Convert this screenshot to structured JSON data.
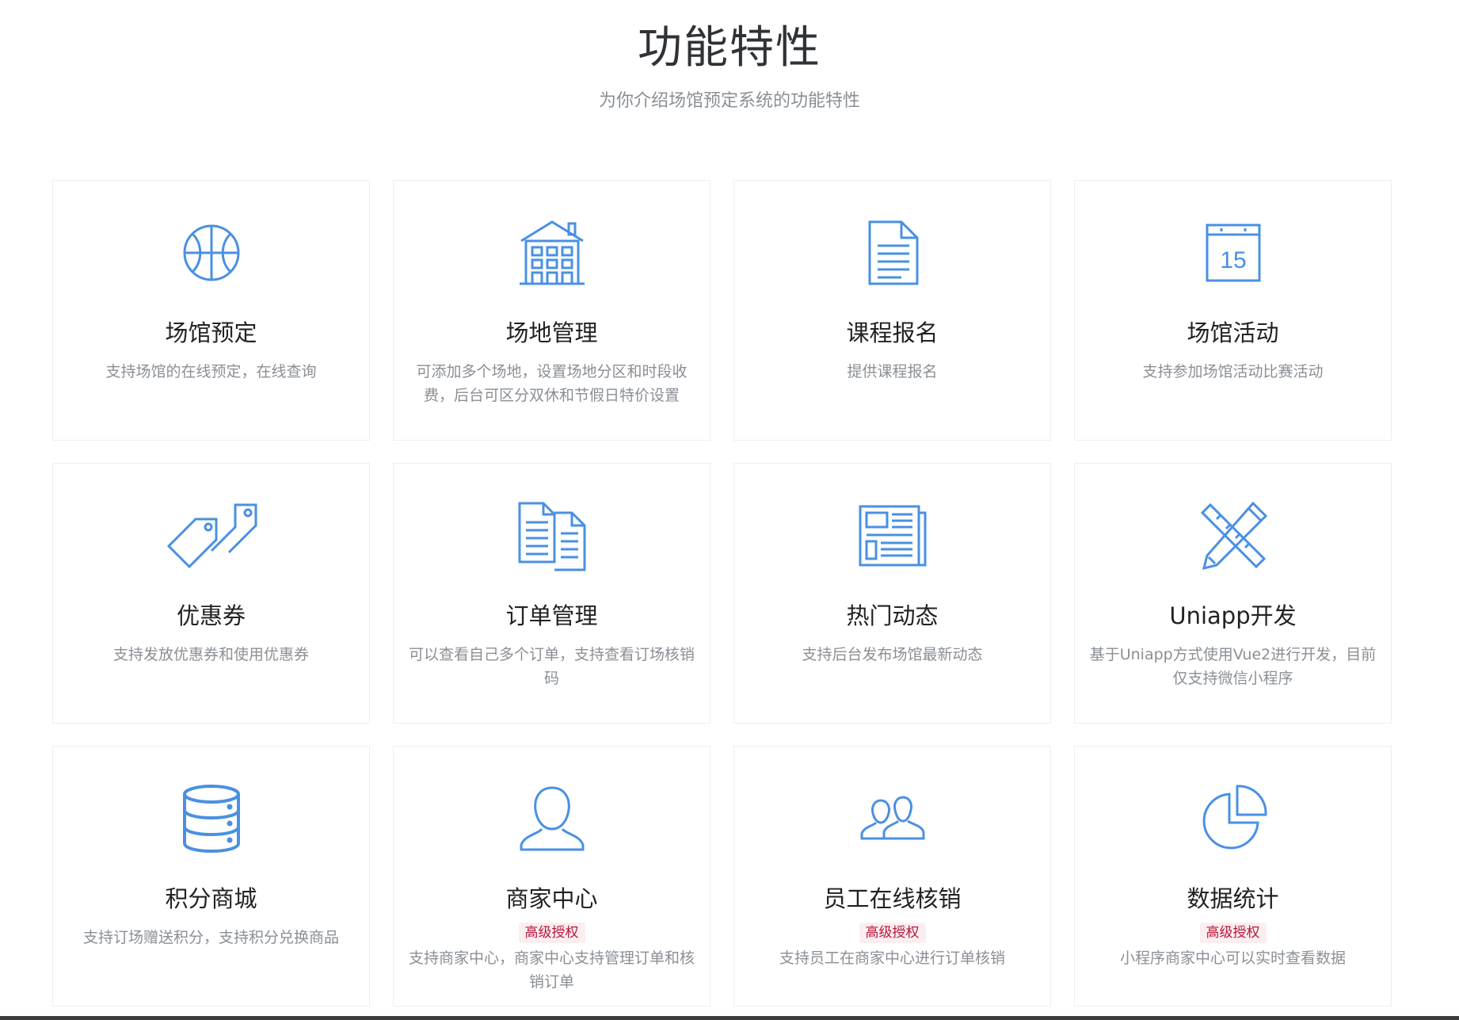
{
  "section": {
    "title": "功能特性",
    "subtitle": "为你介绍场馆预定系统的功能特性"
  },
  "accent_color": "#4a90e2",
  "badge_color": "#b5173a",
  "cards": [
    {
      "icon": "basketball-icon",
      "title": "场馆预定",
      "desc": "支持场馆的在线预定，在线查询",
      "badge": ""
    },
    {
      "icon": "building-icon",
      "title": "场地管理",
      "desc": "可添加多个场地，设置场地分区和时段收费，后台可区分双休和节假日特价设置",
      "badge": ""
    },
    {
      "icon": "document-icon",
      "title": "课程报名",
      "desc": "提供课程报名",
      "badge": ""
    },
    {
      "icon": "calendar-icon",
      "title": "场馆活动",
      "desc": "支持参加场馆活动比赛活动",
      "badge": "",
      "icon_text": "15"
    },
    {
      "icon": "tags-icon",
      "title": "优惠券",
      "desc": "支持发放优惠券和使用优惠券",
      "badge": ""
    },
    {
      "icon": "documents-icon",
      "title": "订单管理",
      "desc": "可以查看自己多个订单，支持查看订场核销码",
      "badge": ""
    },
    {
      "icon": "newspaper-icon",
      "title": "热门动态",
      "desc": "支持后台发布场馆最新动态",
      "badge": ""
    },
    {
      "icon": "ruler-pencil-icon",
      "title": "Uniapp开发",
      "desc": "基于Uniapp方式使用Vue2进行开发，目前仅支持微信小程序",
      "badge": ""
    },
    {
      "icon": "database-icon",
      "title": "积分商城",
      "desc": "支持订场赠送积分，支持积分兑换商品",
      "badge": ""
    },
    {
      "icon": "user-icon",
      "title": "商家中心",
      "desc": "支持商家中心，商家中心支持管理订单和核销订单",
      "badge": "高级授权"
    },
    {
      "icon": "users-icon",
      "title": "员工在线核销",
      "desc": "支持员工在商家中心进行订单核销",
      "badge": "高级授权"
    },
    {
      "icon": "pie-chart-icon",
      "title": "数据统计",
      "desc": "小程序商家中心可以实时查看数据",
      "badge": "高级授权"
    }
  ]
}
